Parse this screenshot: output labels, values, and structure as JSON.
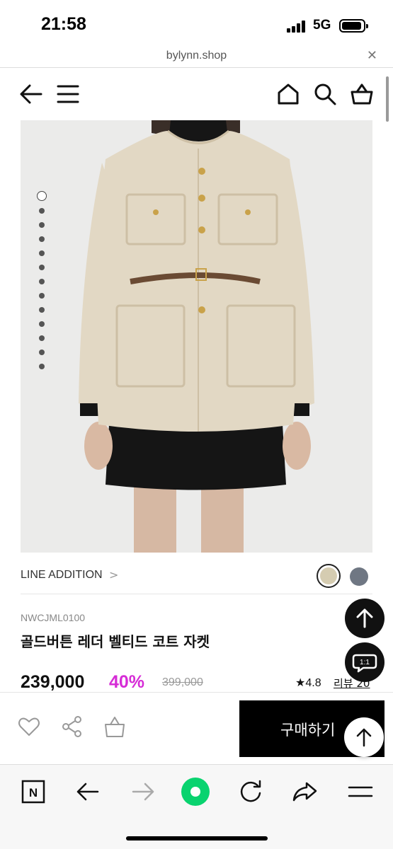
{
  "status_bar": {
    "time": "21:58",
    "network": "5G",
    "icons": [
      "signal-icon",
      "battery-icon"
    ]
  },
  "url_bar": {
    "url": "bylynn.shop",
    "close_icon": "close-icon",
    "close_glyph": "✕"
  },
  "header": {
    "icons": [
      "back-arrow-icon",
      "menu-icon",
      "home-icon",
      "search-icon",
      "cart-icon"
    ]
  },
  "gallery": {
    "image": "product-photo",
    "slide_count": 13,
    "active_slide": 1
  },
  "product": {
    "line_label": "LINE ADDITION",
    "line_chevron": ">",
    "colors": [
      "#d5ccb1",
      "#6f7783"
    ],
    "selected_color": 1,
    "sku": "NWCJML0100",
    "title": "골드버튼 레더 벨티드 코트 자켓",
    "price": "239,000",
    "discount": "40%",
    "original_price": "399,000",
    "rating": "★4.8",
    "review_label": "리뷰 20",
    "discount_color": "#d62cd6"
  },
  "floating": {
    "scroll_top_icon": "arrow-up-icon",
    "chat_icon": "chat-bubble-icon",
    "chat_text": "1:1"
  },
  "buy_bar": {
    "icons": [
      "heart-icon",
      "share-icon",
      "shopping-bag-icon"
    ],
    "buy_label": "구매하기"
  },
  "browser_toolbar": {
    "n_label": "N",
    "icons": [
      "naver-n-icon",
      "back-icon",
      "forward-icon",
      "naver-green-button-icon",
      "reload-icon",
      "share-forward-icon",
      "tabs-menu-icon"
    ],
    "accent": "#09d36f"
  }
}
